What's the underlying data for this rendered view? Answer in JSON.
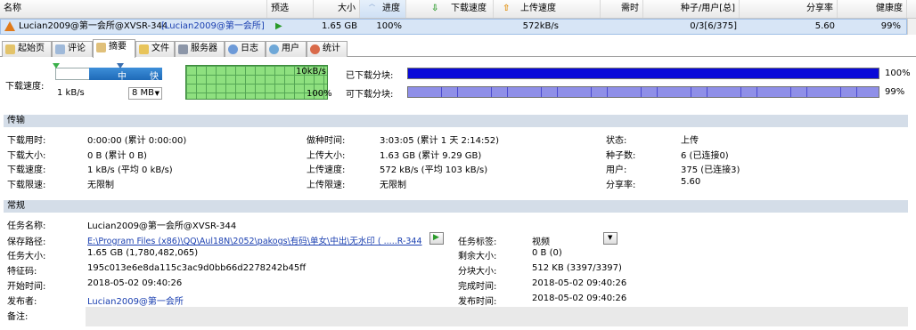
{
  "list": {
    "columns": [
      "名称",
      "预选",
      "大小",
      "进度",
      "下载速度",
      "上传速度",
      "需时",
      "种子/用户[总]",
      "分享率",
      "健康度"
    ],
    "row": {
      "name": "Lucian2009@第一会所@XVSR-344",
      "publisher": "[Lucian2009@第一会所]",
      "size": "1.65 GB",
      "progress": "100%",
      "up_speed": "572kB/s",
      "seeds_peers": "0/3[6/375]",
      "ratio": "5.60",
      "health": "99%"
    }
  },
  "tabs": [
    "起始页",
    "评论",
    "摘要",
    "文件",
    "服务器",
    "日志",
    "用户",
    "统计"
  ],
  "speed": {
    "label": "下载速度:",
    "slider_mid": "中",
    "slider_high": "快",
    "min_value": "1 kB/s",
    "max_select": "8 MB",
    "graph_top": "10kB/s",
    "graph_bottom": "100%",
    "downloaded_label": "已下载分块:",
    "downloaded_pct": "100%",
    "available_label": "可下载分块:",
    "available_pct": "99%"
  },
  "transfer": {
    "title": "传输",
    "download_time_label": "下载用时:",
    "download_time": "0:00:00 (累计 0:00:00)",
    "download_size_label": "下载大小:",
    "download_size": "0 B (累计 0 B)",
    "download_speed_label": "下载速度:",
    "download_speed": "1 kB/s (平均 0 kB/s)",
    "download_limit_label": "下载限速:",
    "download_limit": "无限制",
    "seed_time_label": "做种时间:",
    "seed_time": "3:03:05 (累计 1 天 2:14:52)",
    "upload_size_label": "上传大小:",
    "upload_size": "1.63 GB (累计 9.29 GB)",
    "upload_speed_label": "上传速度:",
    "upload_speed": "572 kB/s (平均 103 kB/s)",
    "upload_limit_label": "上传限速:",
    "upload_limit": "无限制",
    "status_label": "状态:",
    "status": "上传",
    "seeds_label": "种子数:",
    "seeds": "6 (已连接0)",
    "peers_label": "用户:",
    "peers": "375 (已连接3)",
    "ratio_label": "分享率:",
    "ratio": "5.60"
  },
  "general": {
    "title": "常规",
    "name_label": "任务名称:",
    "name": "Lucian2009@第一会所@XVSR-344",
    "path_label": "保存路径:",
    "path": "E:\\Program Files (x86)\\QQ\\Aul18N\\2052\\pakogs\\有码\\单女\\中出\\无水印 ( .....R-344",
    "size_label": "任务大小:",
    "size": "1.65 GB (1,780,482,065)",
    "hash_label": "特征码:",
    "hash": "195c013e6e8da115c3ac9d0bb66d2278242b45ff",
    "start_label": "开始时间:",
    "start": "2018-05-02 09:40:26",
    "publisher_label": "发布者:",
    "publisher": "Lucian2009@第一会所",
    "notes_label": "备注:",
    "tag_label": "任务标签:",
    "tag": "视频",
    "remaining_label": "剩余大小:",
    "remaining": "0 B (0)",
    "piece_label": "分块大小:",
    "piece": "512 KB (3397/3397)",
    "complete_label": "完成时间:",
    "complete": "2018-05-02 09:40:26",
    "publish_time_label": "发布时间:",
    "publish_time": "2018-05-02 09:40:26"
  }
}
